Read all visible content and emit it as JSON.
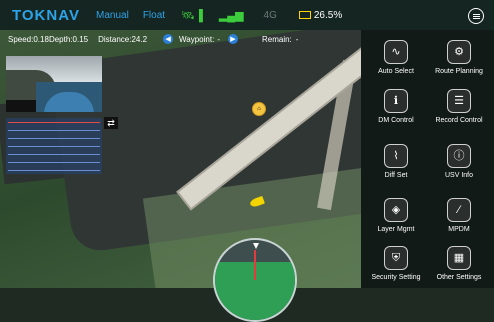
{
  "app": {
    "logo": "TOKNAV"
  },
  "status_bar": {
    "mode_manual": "Manual",
    "mode_float": "Float",
    "signal_label": "4G",
    "battery_percent": "26.5%",
    "battery_color": "#ffd400",
    "accent_color": "#2da3e8"
  },
  "info_bar": {
    "speed_label": "Speed:",
    "speed_value": "0.18",
    "depth_label": "Depth:",
    "depth_value": "0.15",
    "distance_label": "Distance:",
    "distance_value": "24.2",
    "waypoint_label": "Waypoint:",
    "waypoint_value": "-",
    "remain_label": "Remain:",
    "remain_value": "-"
  },
  "panel_buttons": [
    {
      "label": "Auto Select",
      "icon": "waveform-icon"
    },
    {
      "label": "Route Planning",
      "icon": "gear-icon"
    },
    {
      "label": "DM Control",
      "icon": "info-box-icon"
    },
    {
      "label": "Record Control",
      "icon": "list-icon"
    },
    {
      "label": "Diff Set",
      "icon": "chart-icon"
    },
    {
      "label": "USV Info",
      "icon": "info-circle-icon"
    },
    {
      "label": "Layer Mgmt",
      "icon": "layers-icon"
    },
    {
      "label": "MPDM",
      "icon": "pen-icon"
    },
    {
      "label": "Security Setting",
      "icon": "shield-icon"
    },
    {
      "label": "Other Settings",
      "icon": "grid-icon"
    }
  ]
}
